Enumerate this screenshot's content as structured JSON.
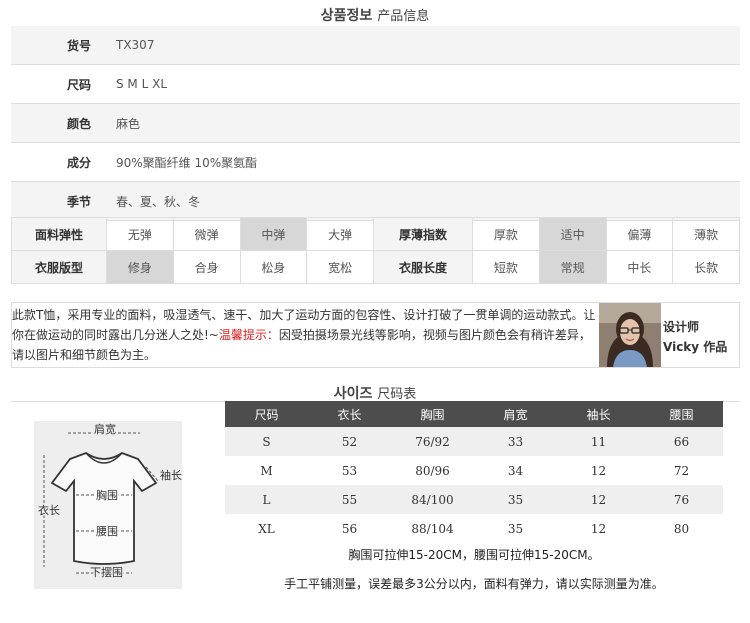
{
  "product_title": {
    "ko": "상품정보",
    "zh": "产品信息"
  },
  "info": [
    {
      "label": "货号",
      "value": "TX307"
    },
    {
      "label": "尺码",
      "value": "S M L XL"
    },
    {
      "label": "颜色",
      "value": "麻色"
    },
    {
      "label": "成分",
      "value": "90%聚酯纤维 10%聚氨酯"
    },
    {
      "label": "季节",
      "value": "春、夏、秋、冬"
    }
  ],
  "attributes": {
    "row1": {
      "label_a": "面料弹性",
      "a": [
        "无弹",
        "微弹",
        "中弹",
        "大弹"
      ],
      "a_selected": "中弹",
      "label_b": "厚薄指数",
      "b": [
        "厚款",
        "适中",
        "偏薄",
        "薄款"
      ],
      "b_selected": "适中"
    },
    "row2": {
      "label_a": "衣服版型",
      "a": [
        "修身",
        "合身",
        "松身",
        "宽松"
      ],
      "a_selected": "修身",
      "label_b": "衣服长度",
      "b": [
        "短款",
        "常规",
        "中长",
        "长款"
      ],
      "b_selected": "常规"
    }
  },
  "description": {
    "line1": "此款T恤，采用专业的面料，吸湿透气、速干、加大了运动方面的包容性、设计打破了一贯单调的运动款式。让",
    "line2_pre": "你在做运动的同时露出几分迷人之处!~",
    "line2_warn": "温馨提示：",
    "line2_post": "因受拍摄场景光线等影响，视频与图片颜色会有稍许差异，",
    "line3": "请以图片和细节颜色为主。",
    "designer_label": "设计师",
    "designer_name": "Vicky 作品"
  },
  "size_title": {
    "ko": "사이즈",
    "zh": "尺码表"
  },
  "diagram_labels": {
    "shoulder": "肩宽",
    "sleeve": "袖长",
    "chest": "胸围",
    "length": "衣长",
    "waist": "腰围",
    "hem": "下摆围"
  },
  "size_table": {
    "headers": [
      "尺码",
      "衣长",
      "胸围",
      "肩宽",
      "袖长",
      "腰围"
    ],
    "rows": [
      [
        "S",
        "52",
        "76/92",
        "33",
        "11",
        "66"
      ],
      [
        "M",
        "53",
        "80/96",
        "34",
        "12",
        "72"
      ],
      [
        "L",
        "55",
        "84/100",
        "35",
        "12",
        "76"
      ],
      [
        "XL",
        "56",
        "88/104",
        "35",
        "12",
        "80"
      ]
    ]
  },
  "notes": {
    "stretch": "胸围可拉伸15-20CM，腰围可拉伸15-20CM。",
    "measure": "手工平铺测量，误差最多3公分以内，面料有弹力，请以实际测量为准。"
  }
}
